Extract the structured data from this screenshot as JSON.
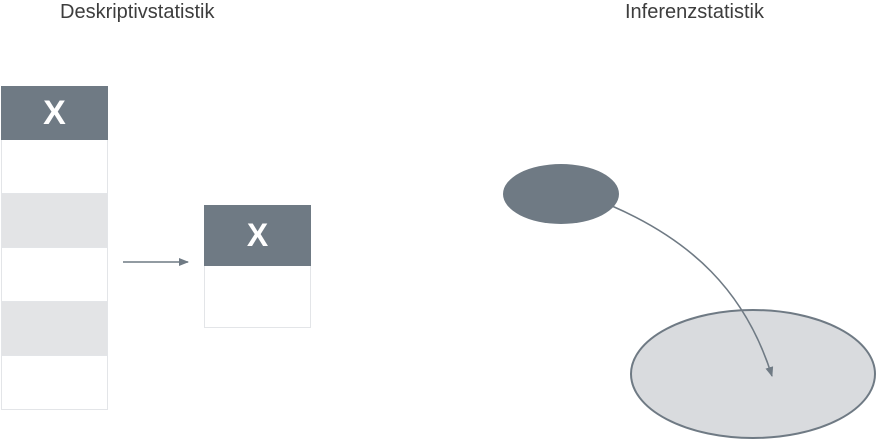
{
  "titles": {
    "descriptive": "Deskriptivstatistik",
    "inferential": "Inferenzstatistik"
  },
  "data_table": {
    "header": "X",
    "rows": [
      "",
      "shaded",
      "",
      "shaded",
      ""
    ]
  },
  "summary_table": {
    "header": "X"
  },
  "colors": {
    "header_fill": "#6f7a84",
    "sample_fill": "#6f7a84",
    "population_fill": "#d9dbde",
    "population_stroke": "#6f7a84",
    "arrow": "#6f7a84",
    "shaded_row": "#e3e4e6"
  },
  "icons": {
    "sample": "sample-ellipse",
    "population": "population-ellipse"
  }
}
